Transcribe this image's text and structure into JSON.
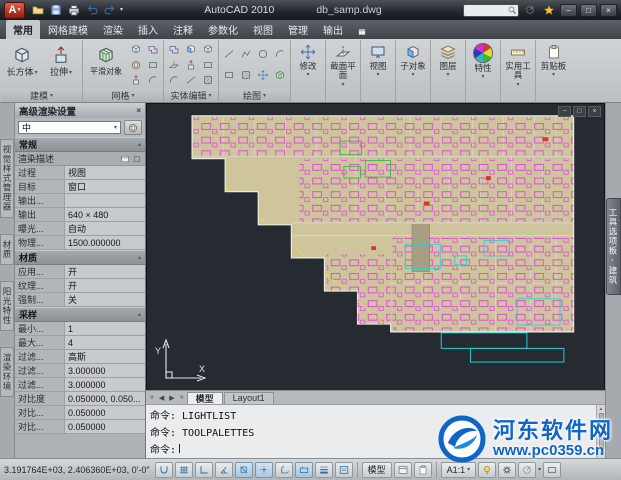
{
  "glyphs": {
    "caret_down": "▾",
    "section_up": "▴",
    "minimize": "−",
    "maximize": "□",
    "close": "×",
    "nav_first": "«",
    "nav_prev": "◀",
    "nav_next": "▶",
    "nav_last": "»"
  },
  "colors": {
    "canvas_bg": "#262b32",
    "plan_fill": "#cfc59d",
    "magenta": "#e23ae2",
    "cyan": "#25d2d2",
    "accent_green": "#2fbf3a",
    "accent_yellow": "#efe335",
    "logo_red": "#a51f13",
    "watermark_blue": "#1065c9"
  },
  "titlebar": {
    "logo_letter": "A",
    "app_title": "AutoCAD 2010",
    "doc_name": "db_samp.dwg"
  },
  "ribbon_tabs": [
    {
      "label": "常用"
    },
    {
      "label": "网格建模"
    },
    {
      "label": "渲染"
    },
    {
      "label": "插入"
    },
    {
      "label": "注释"
    },
    {
      "label": "参数化"
    },
    {
      "label": "视图"
    },
    {
      "label": "管理"
    },
    {
      "label": "输出"
    }
  ],
  "ribbon": {
    "box_label": "长方体",
    "extrude_label": "拉伸",
    "smooth_label": "平滑对象",
    "modify_label": "修改",
    "section_label": "截面平面",
    "view_label": "视图",
    "subobject_label": "子对象",
    "layers_label": "图层",
    "properties_label": "特性",
    "utilities_label": "实用工具",
    "clipboard_label": "剪贴板",
    "group_modeling": "建模",
    "group_mesh": "网格",
    "group_solid": "实体编辑",
    "group_draw": "绘图"
  },
  "left_tabs": [
    "视觉样式管理器",
    "材质",
    "阳光特性",
    "渲染环境"
  ],
  "palette": {
    "title": "高级渲染设置",
    "preset_value": "中",
    "sec_general": "常规",
    "sub_general": "渲染描述",
    "general_rows": [
      {
        "k": "过程",
        "v": "视图"
      },
      {
        "k": "目标",
        "v": "窗口"
      },
      {
        "k": "输出...",
        "v": ""
      },
      {
        "k": "输出",
        "v": "640 × 480"
      },
      {
        "k": "曝光...",
        "v": "自动"
      },
      {
        "k": "物理...",
        "v": "1500.000000"
      }
    ],
    "sec_material": "材质",
    "material_rows": [
      {
        "k": "应用...",
        "v": "开"
      },
      {
        "k": "纹理...",
        "v": "开"
      },
      {
        "k": "强制...",
        "v": "关"
      }
    ],
    "sec_sampling": "采样",
    "sampling_rows": [
      {
        "k": "最小...",
        "v": "1"
      },
      {
        "k": "最大...",
        "v": "4"
      },
      {
        "k": "过滤...",
        "v": "高斯"
      },
      {
        "k": "过滤...",
        "v": "3.000000"
      },
      {
        "k": "过滤...",
        "v": "3.000000"
      },
      {
        "k": "对比度",
        "v": "0.050000, 0.050..."
      },
      {
        "k": "对比...",
        "v": "0.050000"
      },
      {
        "k": "对比...",
        "v": "0.050000"
      }
    ]
  },
  "viewport": {
    "ucs_x": "X",
    "ucs_y": "Y",
    "right_tab": "工具选项板 - 建筑"
  },
  "layout_bar": {
    "tabs": [
      {
        "label": "模型"
      },
      {
        "label": "Layout1"
      }
    ]
  },
  "command": {
    "lines": [
      "命令:  LIGHTLIST",
      "命令:  TOOLPALETTES"
    ],
    "prompt": "命令:"
  },
  "statusbar": {
    "coords": "3.191764E+03, 2.406360E+03, 0'-0\"",
    "model_label": "模型",
    "scale_label": "A1:1"
  },
  "watermark": {
    "site": "河东软件网",
    "url": "www.pc0359.cn"
  }
}
